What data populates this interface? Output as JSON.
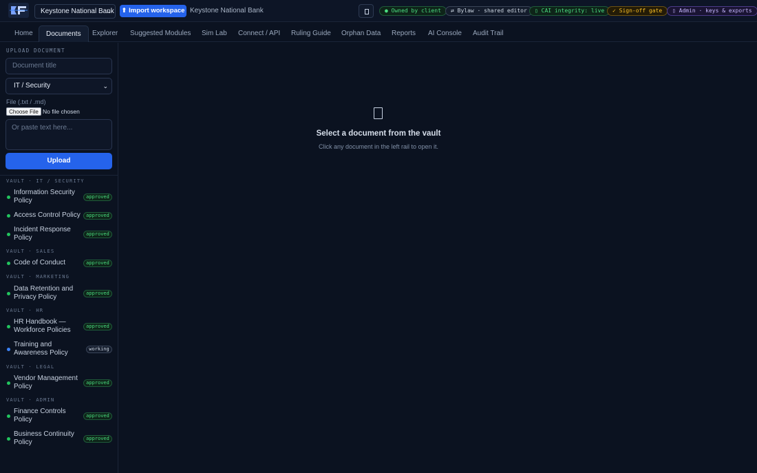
{
  "header": {
    "org_select": "Keystone National Bank",
    "import_button": "⬆ Import workspace",
    "bank_name": "Keystone National Bank",
    "pills": {
      "owned": "● Owned by client",
      "bylaw": "⇄ Bylaw · shared editor",
      "cai": "▯ CAI integrity: live",
      "signoff": "✓ Sign-off gate",
      "admin": "▯ Admin · keys & exports"
    },
    "colors": {
      "accent": "#2563eb",
      "ok": "#4ade80",
      "warn": "#fbbf24",
      "admin": "#c4b5fd"
    }
  },
  "nav": {
    "tabs": [
      {
        "label": "Home"
      },
      {
        "label": "Documents",
        "active": true
      },
      {
        "label": "Explorer"
      },
      {
        "label": "Suggested Modules"
      },
      {
        "label": "Sim Lab"
      },
      {
        "label": "Connect / API"
      },
      {
        "label": "Ruling Guide"
      },
      {
        "label": "Orphan Data"
      },
      {
        "label": "Reports"
      },
      {
        "label": "AI Console"
      },
      {
        "label": "Audit Trail"
      }
    ]
  },
  "upload": {
    "section_label": "UPLOAD DOCUMENT",
    "title_placeholder": "Document title",
    "category_value": "IT / Security",
    "file_label": "File (.txt / .md)",
    "choose_file": "Choose File",
    "no_file": "No file chosen",
    "paste_placeholder": "Or paste text here...",
    "upload_button": "Upload"
  },
  "vault": {
    "groups": [
      {
        "label": "VAULT · IT / SECURITY",
        "docs": [
          {
            "name": "Information Security Policy",
            "status": "approved"
          },
          {
            "name": "Access Control Policy",
            "status": "approved"
          },
          {
            "name": "Incident Response Policy",
            "status": "approved"
          }
        ]
      },
      {
        "label": "VAULT · SALES",
        "docs": [
          {
            "name": "Code of Conduct",
            "status": "approved"
          }
        ]
      },
      {
        "label": "VAULT · MARKETING",
        "docs": [
          {
            "name": "Data Retention and Privacy Policy",
            "status": "approved"
          }
        ]
      },
      {
        "label": "VAULT · HR",
        "docs": [
          {
            "name": "HR Handbook — Workforce Policies",
            "status": "approved"
          },
          {
            "name": "Training and Awareness Policy",
            "status": "working"
          }
        ]
      },
      {
        "label": "VAULT · LEGAL",
        "docs": [
          {
            "name": "Vendor Management Policy",
            "status": "approved"
          }
        ]
      },
      {
        "label": "VAULT · ADMIN",
        "docs": [
          {
            "name": "Finance Controls Policy",
            "status": "approved"
          },
          {
            "name": "Business Continuity Policy",
            "status": "approved"
          }
        ]
      }
    ],
    "status_colors": {
      "approved": "#22c55e",
      "working": "#3b82f6"
    }
  },
  "main": {
    "empty_title": "Select a document from the vault",
    "empty_subtitle": "Click any document in the left rail to open it."
  }
}
